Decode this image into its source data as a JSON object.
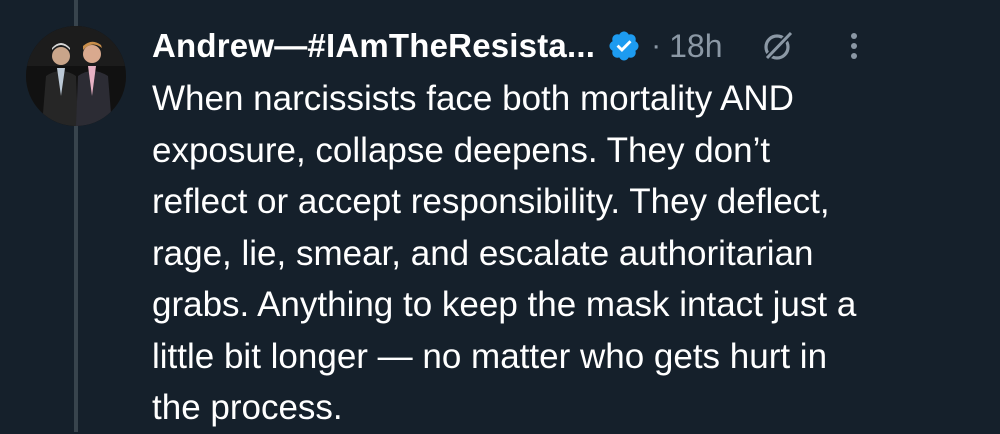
{
  "author": {
    "display_name": "Andrew—#IAmTheResista...",
    "verified": true,
    "separator": "·",
    "timestamp": "18h"
  },
  "tweet": {
    "lines": [
      "When narcissists face both mortality AND",
      "exposure, collapse deepens. They don’t",
      "reflect or accept responsibility. They deflect,",
      "rage, lie, smear, and escalate authoritarian",
      "grabs. Anything to keep the mask intact just a",
      "little bit longer — no matter who gets hurt in",
      "the process."
    ]
  },
  "icons": {
    "verified": "verified-badge-icon",
    "grok": "grok-icon",
    "more": "more-options-icon"
  },
  "colors": {
    "background": "#15202b",
    "text": "#ffffff",
    "muted": "#8b98a5",
    "verified": "#1d9bf0",
    "thread_line": "#38444d"
  }
}
